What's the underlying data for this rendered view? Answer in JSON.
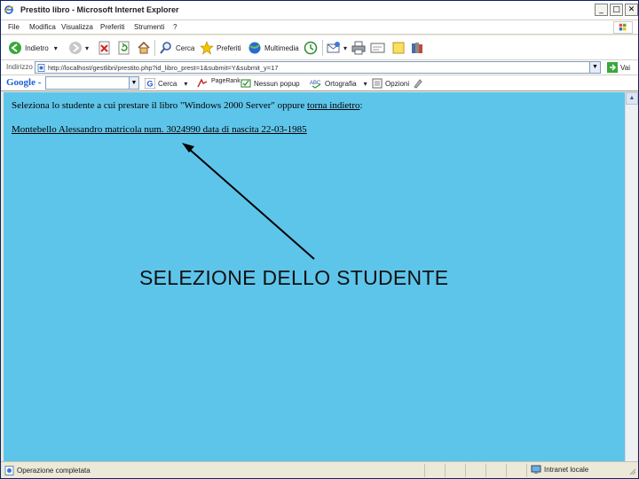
{
  "window": {
    "title": "Prestito libro - Microsoft Internet Explorer",
    "controls": {
      "minimize": "_",
      "maximize": "□",
      "close": "✕"
    }
  },
  "menubar": {
    "items": [
      "File",
      "Modifica",
      "Visualizza",
      "Preferiti",
      "Strumenti",
      "?"
    ]
  },
  "toolbar": {
    "back_label": "Indietro",
    "search_label": "Cerca",
    "favorites_label": "Preferiti",
    "multimedia_label": "Multimedia"
  },
  "address": {
    "label": "Indirizzo",
    "url": "http://localhost/gestlibri/prestito.php?id_libro_prest=1&submit=Y&submit_y=17",
    "go_label": "Vai"
  },
  "google_toolbar": {
    "logo": "Google -",
    "search_label": "Cerca",
    "pagerank_label": "PageRank",
    "popup_label": "Nessun popup",
    "spelling_label": "Ortografia",
    "options_label": "Opzioni"
  },
  "page": {
    "intro_prefix": "Seleziona lo studente a cui prestare il libro \"Windows 2000 Server\" oppure ",
    "back_link": "torna indietro",
    "intro_suffix": ":",
    "student_link": "Montebello Alessandro matricola num. 3024990 data di nascita 22-03-1985"
  },
  "annotation": {
    "text": "SELEZIONE DELLO STUDENTE"
  },
  "statusbar": {
    "status_text": "Operazione completata",
    "zone_label": "Intranet locale"
  },
  "colors": {
    "page_background": "#5ec5ea",
    "chrome": "#ece9d8"
  }
}
